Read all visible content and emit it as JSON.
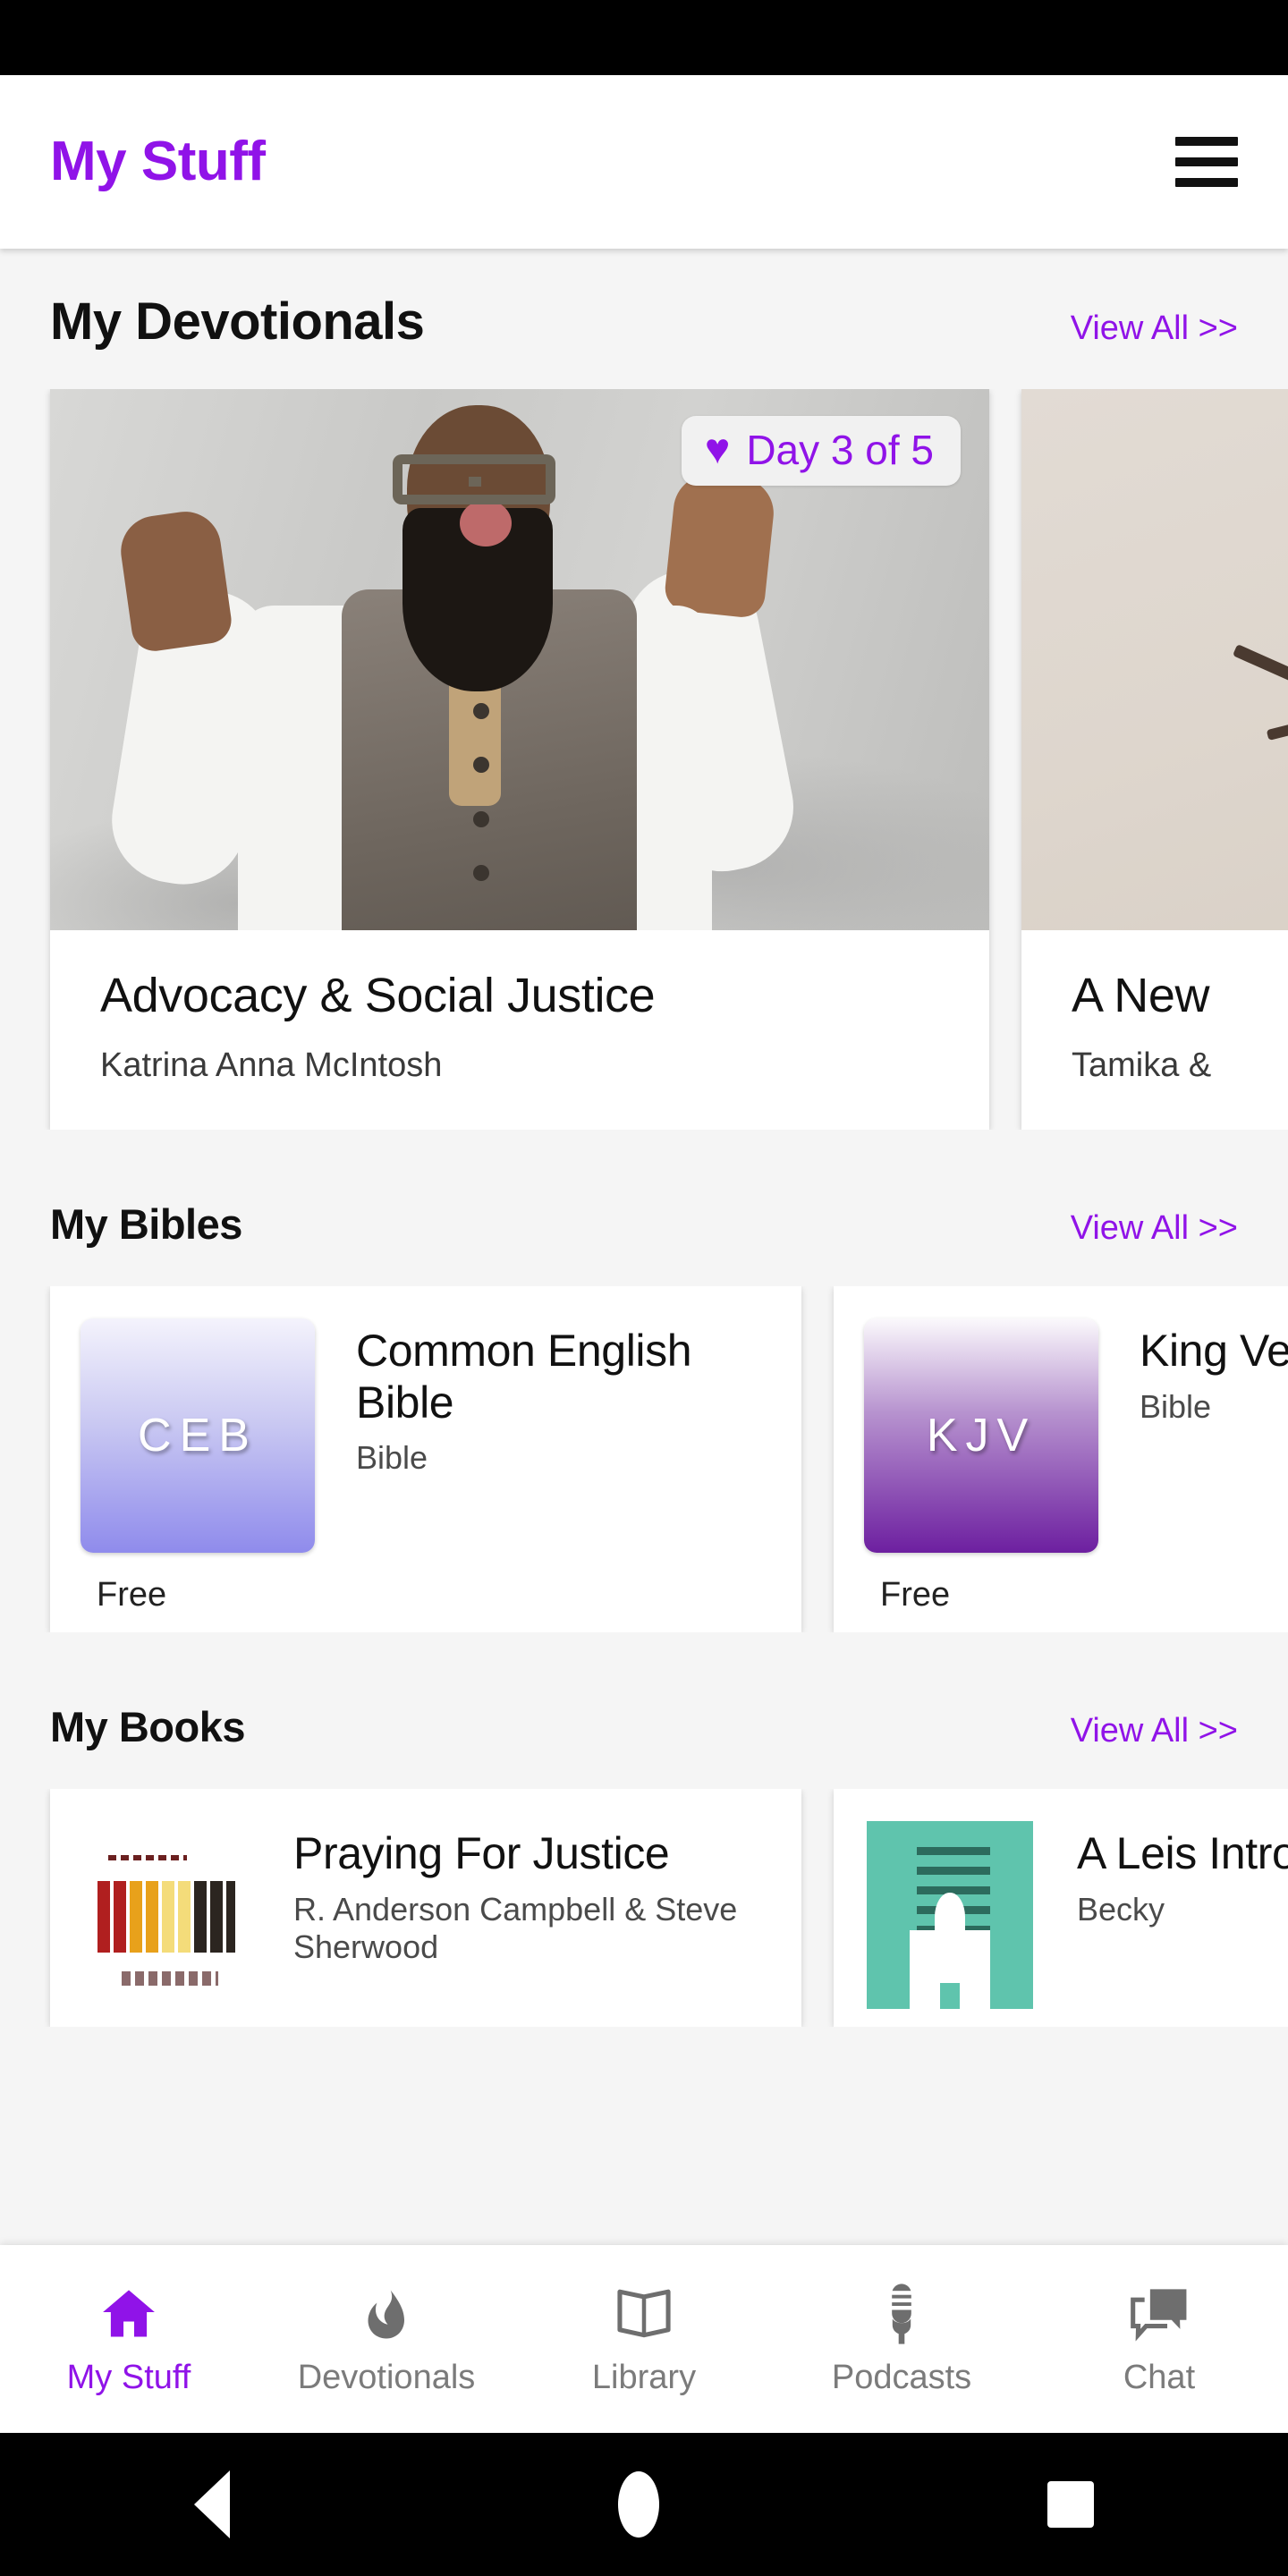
{
  "app": {
    "title": "My Stuff",
    "accent_color": "#9013e8",
    "menu_icon": "hamburger-menu-icon",
    "background_color": "#f5f5f5"
  },
  "sections": {
    "devotionals": {
      "title": "My Devotionals",
      "view_all": "View All >>",
      "cards": [
        {
          "badge_icon": "heart-icon",
          "badge_text": "Day 3 of 5",
          "title": "Advocacy & Social Justice",
          "author": "Katrina Anna McIntosh",
          "image": "man-with-glasses-hands-raised-photo"
        },
        {
          "title": "A New",
          "author": "Tamika &",
          "image": "flowers-on-pavement-photo"
        }
      ]
    },
    "bibles": {
      "title": "My Bibles",
      "view_all": "View All >>",
      "cards": [
        {
          "abbr": "CEB",
          "title": "Common English Bible",
          "subtitle": "Bible",
          "price": "Free",
          "thumb_gradient_from": "#f4f3fc",
          "thumb_gradient_to": "#8f8bec"
        },
        {
          "abbr": "KJV",
          "title": "King Vers",
          "subtitle": "Bible",
          "price": "Free",
          "thumb_gradient_from": "#fbf9fc",
          "thumb_gradient_to": "#6d1fa0"
        }
      ]
    },
    "books": {
      "title": "My Books",
      "view_all": "View All >>",
      "cards": [
        {
          "title": "Praying For Justice",
          "author": "R. Anderson Campbell & Steve Sherwood",
          "cover": "justice-book-cover"
        },
        {
          "title": "A Leis Introd",
          "author": "Becky",
          "cover": "teal-church-book-cover"
        }
      ]
    }
  },
  "tab_bar": {
    "items": [
      {
        "label": "My Stuff",
        "icon": "home-icon",
        "active": true
      },
      {
        "label": "Devotionals",
        "icon": "flame-icon",
        "active": false
      },
      {
        "label": "Library",
        "icon": "book-icon",
        "active": false
      },
      {
        "label": "Podcasts",
        "icon": "microphone-icon",
        "active": false
      },
      {
        "label": "Chat",
        "icon": "chat-bubble-icon",
        "active": false
      }
    ]
  },
  "system_nav": {
    "back": "back-triangle-icon",
    "home": "home-circle-icon",
    "recents": "recents-square-icon"
  }
}
